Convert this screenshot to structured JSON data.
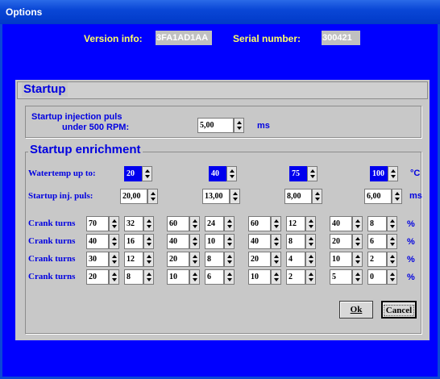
{
  "window": {
    "title": "Options"
  },
  "header": {
    "version_label": "Version info:",
    "version_value": "3FA1AD1AA",
    "serial_label": "Serial number:",
    "serial_value": "300421"
  },
  "startup": {
    "title": "Startup",
    "injection_label_1": "Startup injection puls",
    "injection_label_2": "under 500 RPM:",
    "injection_value": "5,00",
    "injection_unit": "ms"
  },
  "enrichment": {
    "title": "Startup enrichment",
    "watertemp_label": "Watertemp up to:",
    "watertemp_values": [
      "20",
      "40",
      "75",
      "100"
    ],
    "watertemp_unit": "°C",
    "injpuls_label": "Startup inj. puls:",
    "injpuls_values": [
      "20,00",
      "13,00",
      "8,00",
      "6,00"
    ],
    "injpuls_unit": "ms",
    "crank_label": "Crank turns",
    "percent_unit": "%",
    "crank_rows": [
      [
        [
          "70",
          "32"
        ],
        [
          "60",
          "24"
        ],
        [
          "60",
          "12"
        ],
        [
          "40",
          "8"
        ]
      ],
      [
        [
          "40",
          "16"
        ],
        [
          "40",
          "10"
        ],
        [
          "40",
          "8"
        ],
        [
          "20",
          "6"
        ]
      ],
      [
        [
          "30",
          "12"
        ],
        [
          "20",
          "8"
        ],
        [
          "20",
          "4"
        ],
        [
          "10",
          "2"
        ]
      ],
      [
        [
          "20",
          "8"
        ],
        [
          "10",
          "6"
        ],
        [
          "10",
          "2"
        ],
        [
          "5",
          "0"
        ]
      ]
    ]
  },
  "buttons": {
    "ok": "Ok",
    "cancel": "Cancel"
  }
}
